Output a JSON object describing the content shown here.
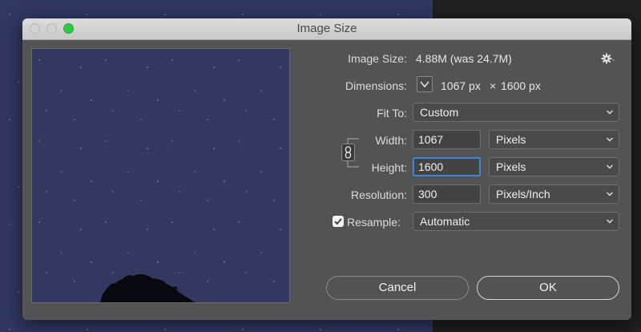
{
  "window": {
    "title": "Image Size"
  },
  "image_size": {
    "label": "Image Size:",
    "value": "4.88M (was 24.7M)"
  },
  "dimensions": {
    "label": "Dimensions:",
    "width_px": "1067 px",
    "times": "×",
    "height_px": "1600 px"
  },
  "fit_to": {
    "label": "Fit To:",
    "value": "Custom"
  },
  "width": {
    "label": "Width:",
    "value": "1067",
    "unit": "Pixels"
  },
  "height": {
    "label": "Height:",
    "value": "1600",
    "unit": "Pixels"
  },
  "resolution": {
    "label": "Resolution:",
    "value": "300",
    "unit": "Pixels/Inch"
  },
  "resample": {
    "label": "Resample:",
    "checked": true,
    "value": "Automatic"
  },
  "buttons": {
    "cancel": "Cancel",
    "ok": "OK"
  },
  "icons": {
    "gear": "gear-icon",
    "link": "chain-link-icon",
    "chevron": "chevron-down-icon",
    "dimensions_toggle": "chevron-down-icon",
    "traffic_lights": [
      "close-icon",
      "minimize-icon",
      "zoom-icon"
    ]
  },
  "colors": {
    "focus": "#3f86d9",
    "zoom_light": "#2fca45",
    "dialog_bg": "#535353"
  }
}
